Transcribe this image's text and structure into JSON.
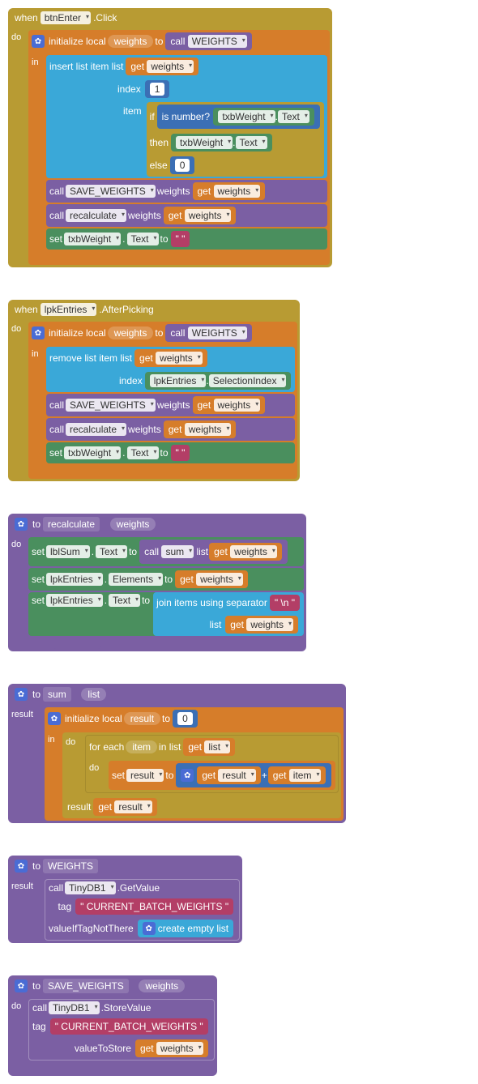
{
  "block1": {
    "when": "when",
    "component": "btnEnter",
    "event": ".Click",
    "do": "do",
    "init_local": "initialize local",
    "var_weights": "weights",
    "to": "to",
    "call": "call",
    "proc_weights": "WEIGHTS",
    "in": "in",
    "insert": "insert list item  list",
    "get": "get",
    "index": "index",
    "index_val": "1",
    "item": "item",
    "if": "if",
    "is_number": "is number?",
    "txb": "txbWeight",
    "text": "Text",
    "then": "then",
    "else": "else",
    "zero": "0",
    "save_proc": "SAVE_WEIGHTS",
    "weights_arg": "weights",
    "recalc": "recalculate",
    "set": "set",
    "empty_str": "\" \"",
    "dot": "."
  },
  "block2": {
    "when": "when",
    "component": "lpkEntries",
    "event": ".AfterPicking",
    "do": "do",
    "init_local": "initialize local",
    "var_weights": "weights",
    "to": "to",
    "call": "call",
    "proc_weights": "WEIGHTS",
    "in": "in",
    "remove": "remove list item  list",
    "get": "get",
    "index": "index",
    "sel_idx": "SelectionIndex",
    "save_proc": "SAVE_WEIGHTS",
    "weights_arg": "weights",
    "recalc": "recalculate",
    "set": "set",
    "txb": "txbWeight",
    "text": "Text",
    "empty_str": "\" \"",
    "dot": "."
  },
  "block3": {
    "to": "to",
    "name": "recalculate",
    "param": "weights",
    "do": "do",
    "set": "set",
    "lblsum": "lblSum",
    "text": "Text",
    "call": "call",
    "sum": "sum",
    "list": "list",
    "get": "get",
    "lpk": "lpkEntries",
    "elements": "Elements",
    "join": "join items using separator",
    "nl": "\" \\n \"",
    "dot": "."
  },
  "block4": {
    "to": "to",
    "name": "sum",
    "param": "list",
    "result": "result",
    "init_local": "initialize local",
    "var_result": "result",
    "zero": "0",
    "in": "in",
    "do": "do",
    "foreach": "for each",
    "item": "item",
    "inlist": "in list",
    "get": "get",
    "set": "set",
    "plus": "+",
    "to_kw": "to"
  },
  "block5": {
    "to": "to",
    "name": "WEIGHTS",
    "result": "result",
    "call": "call",
    "tinydb": "TinyDB1",
    "getval": ".GetValue",
    "tag": "tag",
    "tag_val": "\"  CURRENT_BATCH_WEIGHTS  \"",
    "vifnot": "valueIfTagNotThere",
    "empty_list": "create empty list"
  },
  "block6": {
    "to": "to",
    "name": "SAVE_WEIGHTS",
    "param": "weights",
    "do": "do",
    "call": "call",
    "tinydb": "TinyDB1",
    "storeval": ".StoreValue",
    "tag": "tag",
    "tag_val": "\"  CURRENT_BATCH_WEIGHTS  \"",
    "valstore": "valueToStore",
    "get": "get"
  }
}
